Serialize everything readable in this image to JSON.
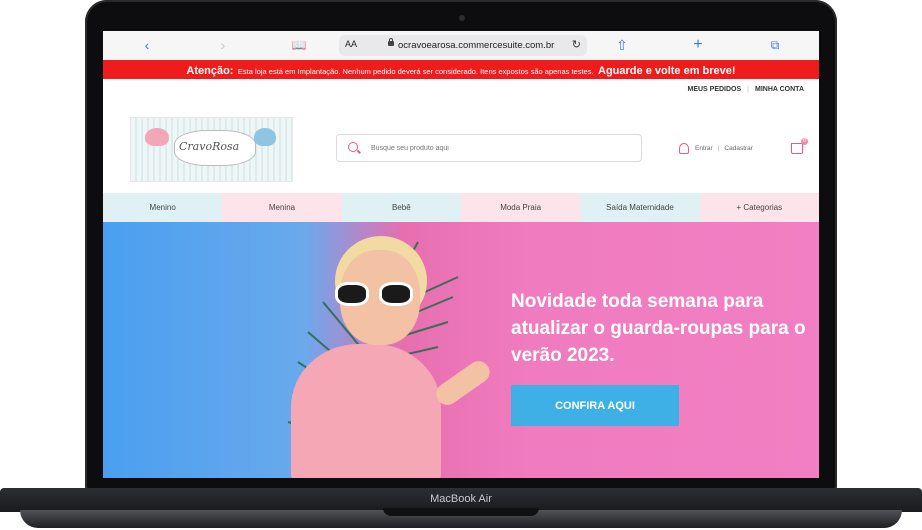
{
  "device": {
    "model_label": "MacBook Air"
  },
  "browser": {
    "aa_label": "AA",
    "url": "ocravoearosa.commercesuite.com.br",
    "icons": [
      "back-icon",
      "forward-icon",
      "bookmarks-icon",
      "reload-icon",
      "share-icon",
      "add-tab-icon",
      "tabs-icon"
    ]
  },
  "alert": {
    "prefix": "Atenção:",
    "message": "Esta loja está em Implantação. Nenhum pedido deverá ser considerado. Itens expostos são apenas testes.",
    "emphasis": "Aguarde e volte em breve!",
    "color": "#ee1c1c"
  },
  "toplinks": {
    "orders": "MEUS PEDIDOS",
    "account": "MINHA CONTA"
  },
  "logo": {
    "brand": "CravoRosa"
  },
  "search": {
    "placeholder": "Busque seu produto aqui"
  },
  "account": {
    "login": "Entrar",
    "signup": "Cadastrar"
  },
  "cart": {
    "count": "0"
  },
  "nav": {
    "items": [
      {
        "label": "Menino"
      },
      {
        "label": "Menina"
      },
      {
        "label": "Bebê"
      },
      {
        "label": "Moda Praia"
      },
      {
        "label": "Saída Maternidade"
      },
      {
        "label": "+ Categorias"
      }
    ]
  },
  "hero": {
    "headline": "Novidade toda semana para atualizar o guarda-roupas para o verão 2023.",
    "cta": "CONFIRA AQUI",
    "cta_color": "#3fb0e6"
  }
}
